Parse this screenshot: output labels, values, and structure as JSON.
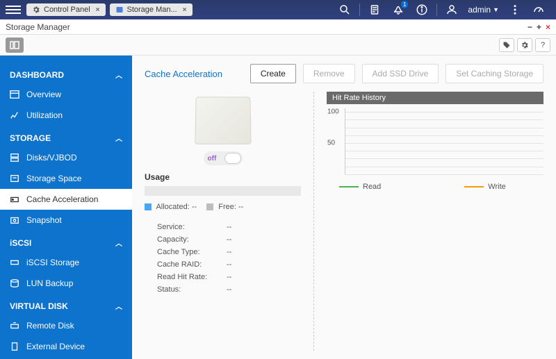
{
  "top": {
    "tabs": [
      {
        "label": "Control Panel"
      },
      {
        "label": "Storage Man..."
      }
    ],
    "admin_label": "admin",
    "notification_count": "1"
  },
  "window": {
    "title": "Storage Manager"
  },
  "sidebar": {
    "sections": [
      {
        "label": "DASHBOARD",
        "items": [
          {
            "label": "Overview"
          },
          {
            "label": "Utilization"
          }
        ]
      },
      {
        "label": "STORAGE",
        "items": [
          {
            "label": "Disks/VJBOD"
          },
          {
            "label": "Storage Space"
          },
          {
            "label": "Cache Acceleration",
            "active": true
          },
          {
            "label": "Snapshot"
          }
        ]
      },
      {
        "label": "iSCSI",
        "items": [
          {
            "label": "iSCSI Storage"
          },
          {
            "label": "LUN Backup"
          }
        ]
      },
      {
        "label": "VIRTUAL DISK",
        "items": [
          {
            "label": "Remote Disk"
          },
          {
            "label": "External Device"
          }
        ]
      }
    ]
  },
  "page": {
    "title": "Cache Acceleration",
    "actions": {
      "create": "Create",
      "remove": "Remove",
      "add_ssd": "Add SSD Drive",
      "set_storage": "Set Caching Storage"
    }
  },
  "cache": {
    "toggle": "off",
    "usage_label": "Usage",
    "legend_allocated_label": "Allocated:",
    "legend_allocated_value": "--",
    "legend_free_label": "Free:",
    "legend_free_value": "--",
    "fields": [
      {
        "label": "Service:",
        "value": "--"
      },
      {
        "label": "Capacity:",
        "value": "--"
      },
      {
        "label": "Cache Type:",
        "value": "--"
      },
      {
        "label": "Cache RAID:",
        "value": "--"
      },
      {
        "label": "Read Hit Rate:",
        "value": "--"
      },
      {
        "label": "Status:",
        "value": "--"
      }
    ],
    "legend_allocated_color": "#4aa6f0",
    "legend_free_color": "#bdbdbd"
  },
  "chart_data": {
    "type": "line",
    "title": "Hit Rate History",
    "ylim": [
      0,
      100
    ],
    "yticks": [
      50,
      100
    ],
    "series": [
      {
        "name": "Read",
        "color": "#4caf50",
        "values": []
      },
      {
        "name": "Write",
        "color": "#ff9800",
        "values": []
      }
    ]
  }
}
